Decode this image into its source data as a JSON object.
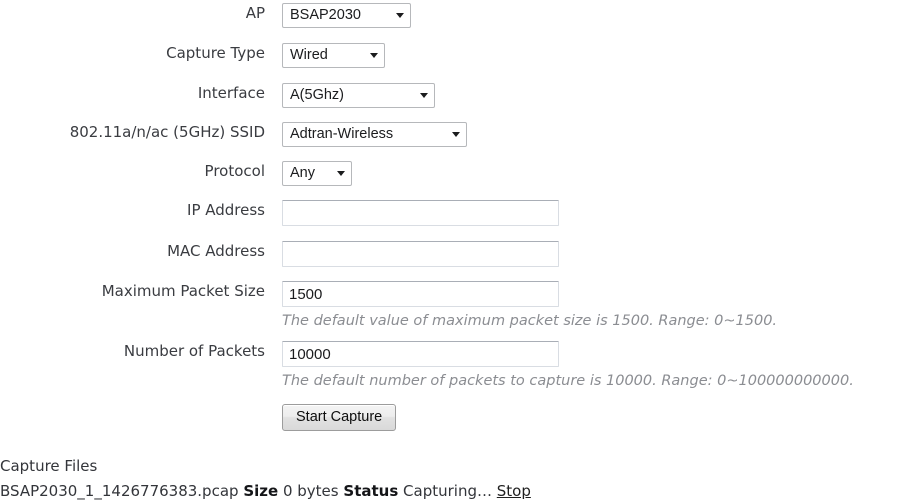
{
  "form": {
    "rows": [
      {
        "label": "AP",
        "control": "select",
        "value": "BSAP2030"
      },
      {
        "label": "Capture Type",
        "control": "select",
        "value": "Wired"
      },
      {
        "label": "Interface",
        "control": "select",
        "value": "A(5Ghz)"
      },
      {
        "label": "802.11a/n/ac (5GHz) SSID",
        "control": "select",
        "value": "Adtran-Wireless"
      },
      {
        "label": "Protocol",
        "control": "select",
        "value": "Any"
      },
      {
        "label": "IP Address",
        "control": "text",
        "value": ""
      },
      {
        "label": "MAC Address",
        "control": "text",
        "value": ""
      },
      {
        "label": "Maximum Packet Size",
        "control": "text",
        "value": "1500",
        "hint": "The default value of maximum packet size is 1500. Range: 0~1500."
      },
      {
        "label": "Number of Packets",
        "control": "text",
        "value": "10000",
        "hint": "The default number of packets to capture is 10000. Range: 0~100000000000."
      }
    ],
    "submit_label": "Start Capture"
  },
  "capture_files": {
    "heading": "Capture Files",
    "file_name": "BSAP2030_1_1426776383.pcap",
    "size_label": "Size",
    "size_value": "0 bytes",
    "status_label": "Status",
    "status_value": "Capturing…",
    "stop_label": "Stop"
  }
}
